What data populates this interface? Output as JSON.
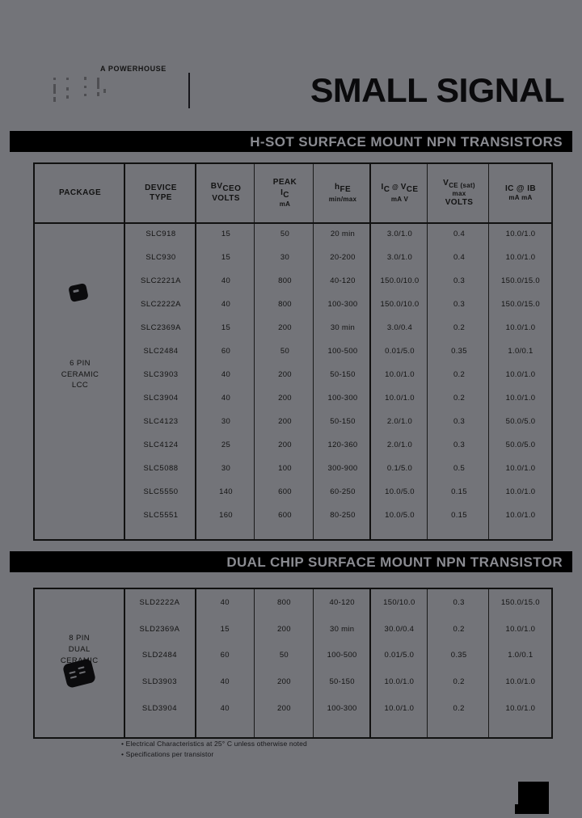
{
  "masthead": {
    "tagline": "A POWERHOUSE",
    "brand_title": "SMALL SIGNAL",
    "logo_name": "semi-logo"
  },
  "sections": [
    {
      "banner": "H-SOT SURFACE MOUNT NPN TRANSISTORS",
      "headers": {
        "package": "PACKAGE",
        "device_type_line1": "DEVICE",
        "device_type_line2": "TYPE",
        "bv_prefix": "BV",
        "bv_sub": "CEO",
        "bv_unit": "VOLTS",
        "peak_line1": "PEAK",
        "peak_symbol": "I",
        "peak_symbol_sub": "C",
        "peak_unit": "mA",
        "hfe_symbol": "h",
        "hfe_sub": "FE",
        "hfe_unit": "min/max",
        "ic_vce_i": "I",
        "ic_vce_i_sub": "C",
        "ic_vce_at": "@",
        "ic_vce_v": "V",
        "ic_vce_v_sub": "CE",
        "ic_vce_units": "mA      V",
        "vcesat_v": "V",
        "vcesat_sub": "CE (sat)",
        "vcesat_max": "max",
        "vcesat_unit": "VOLTS",
        "icib_label": "IC @ IB",
        "icib_unit": "mA  mA"
      },
      "package": [
        "6 PIN",
        "CERAMIC",
        "LCC"
      ],
      "rows": [
        {
          "device": "SLC918",
          "bvceo": "15",
          "peak_ic": "50",
          "hfe": "20 min",
          "ic_vce": "3.0/1.0",
          "vce_sat": "0.4",
          "ic_ib": "10.0/1.0"
        },
        {
          "device": "SLC930",
          "bvceo": "15",
          "peak_ic": "30",
          "hfe": "20-200",
          "ic_vce": "3.0/1.0",
          "vce_sat": "0.4",
          "ic_ib": "10.0/1.0"
        },
        {
          "device": "SLC2221A",
          "bvceo": "40",
          "peak_ic": "800",
          "hfe": "40-120",
          "ic_vce": "150.0/10.0",
          "vce_sat": "0.3",
          "ic_ib": "150.0/15.0"
        },
        {
          "device": "SLC2222A",
          "bvceo": "40",
          "peak_ic": "800",
          "hfe": "100-300",
          "ic_vce": "150.0/10.0",
          "vce_sat": "0.3",
          "ic_ib": "150.0/15.0"
        },
        {
          "device": "SLC2369A",
          "bvceo": "15",
          "peak_ic": "200",
          "hfe": "30 min",
          "ic_vce": "3.0/0.4",
          "vce_sat": "0.2",
          "ic_ib": "10.0/1.0"
        },
        {
          "device": "SLC2484",
          "bvceo": "60",
          "peak_ic": "50",
          "hfe": "100-500",
          "ic_vce": "0.01/5.0",
          "vce_sat": "0.35",
          "ic_ib": "1.0/0.1"
        },
        {
          "device": "SLC3903",
          "bvceo": "40",
          "peak_ic": "200",
          "hfe": "50-150",
          "ic_vce": "10.0/1.0",
          "vce_sat": "0.2",
          "ic_ib": "10.0/1.0"
        },
        {
          "device": "SLC3904",
          "bvceo": "40",
          "peak_ic": "200",
          "hfe": "100-300",
          "ic_vce": "10.0/1.0",
          "vce_sat": "0.2",
          "ic_ib": "10.0/1.0"
        },
        {
          "device": "SLC4123",
          "bvceo": "30",
          "peak_ic": "200",
          "hfe": "50-150",
          "ic_vce": "2.0/1.0",
          "vce_sat": "0.3",
          "ic_ib": "50.0/5.0"
        },
        {
          "device": "SLC4124",
          "bvceo": "25",
          "peak_ic": "200",
          "hfe": "120-360",
          "ic_vce": "2.0/1.0",
          "vce_sat": "0.3",
          "ic_ib": "50.0/5.0"
        },
        {
          "device": "SLC5088",
          "bvceo": "30",
          "peak_ic": "100",
          "hfe": "300-900",
          "ic_vce": "0.1/5.0",
          "vce_sat": "0.5",
          "ic_ib": "10.0/1.0"
        },
        {
          "device": "SLC5550",
          "bvceo": "140",
          "peak_ic": "600",
          "hfe": "60-250",
          "ic_vce": "10.0/5.0",
          "vce_sat": "0.15",
          "ic_ib": "10.0/1.0"
        },
        {
          "device": "SLC5551",
          "bvceo": "160",
          "peak_ic": "600",
          "hfe": "80-250",
          "ic_vce": "10.0/5.0",
          "vce_sat": "0.15",
          "ic_ib": "10.0/1.0"
        }
      ]
    },
    {
      "banner": "DUAL CHIP SURFACE MOUNT NPN TRANSISTOR",
      "package": [
        "8 PIN",
        "DUAL",
        "CERAMIC",
        "LCC"
      ],
      "rows": [
        {
          "device": "SLD2222A",
          "bvceo": "40",
          "peak_ic": "800",
          "hfe": "40-120",
          "ic_vce": "150/10.0",
          "vce_sat": "0.3",
          "ic_ib": "150.0/15.0"
        },
        {
          "device": "SLD2369A",
          "bvceo": "15",
          "peak_ic": "200",
          "hfe": "30 min",
          "ic_vce": "30.0/0.4",
          "vce_sat": "0.2",
          "ic_ib": "10.0/1.0"
        },
        {
          "device": "SLD2484",
          "bvceo": "60",
          "peak_ic": "50",
          "hfe": "100-500",
          "ic_vce": "0.01/5.0",
          "vce_sat": "0.35",
          "ic_ib": "1.0/0.1"
        },
        {
          "device": "SLD3903",
          "bvceo": "40",
          "peak_ic": "200",
          "hfe": "50-150",
          "ic_vce": "10.0/1.0",
          "vce_sat": "0.2",
          "ic_ib": "10.0/1.0"
        },
        {
          "device": "SLD3904",
          "bvceo": "40",
          "peak_ic": "200",
          "hfe": "100-300",
          "ic_vce": "10.0/1.0",
          "vce_sat": "0.2",
          "ic_ib": "10.0/1.0"
        }
      ]
    }
  ],
  "footnotes": [
    "Electrical Characteristics at 25° C unless otherwise noted",
    "Specifications per transistor"
  ],
  "colors": {
    "page_background": "#737479",
    "banner_background": "#000000",
    "banner_text": "#8a8b91",
    "ink": "#131313"
  }
}
